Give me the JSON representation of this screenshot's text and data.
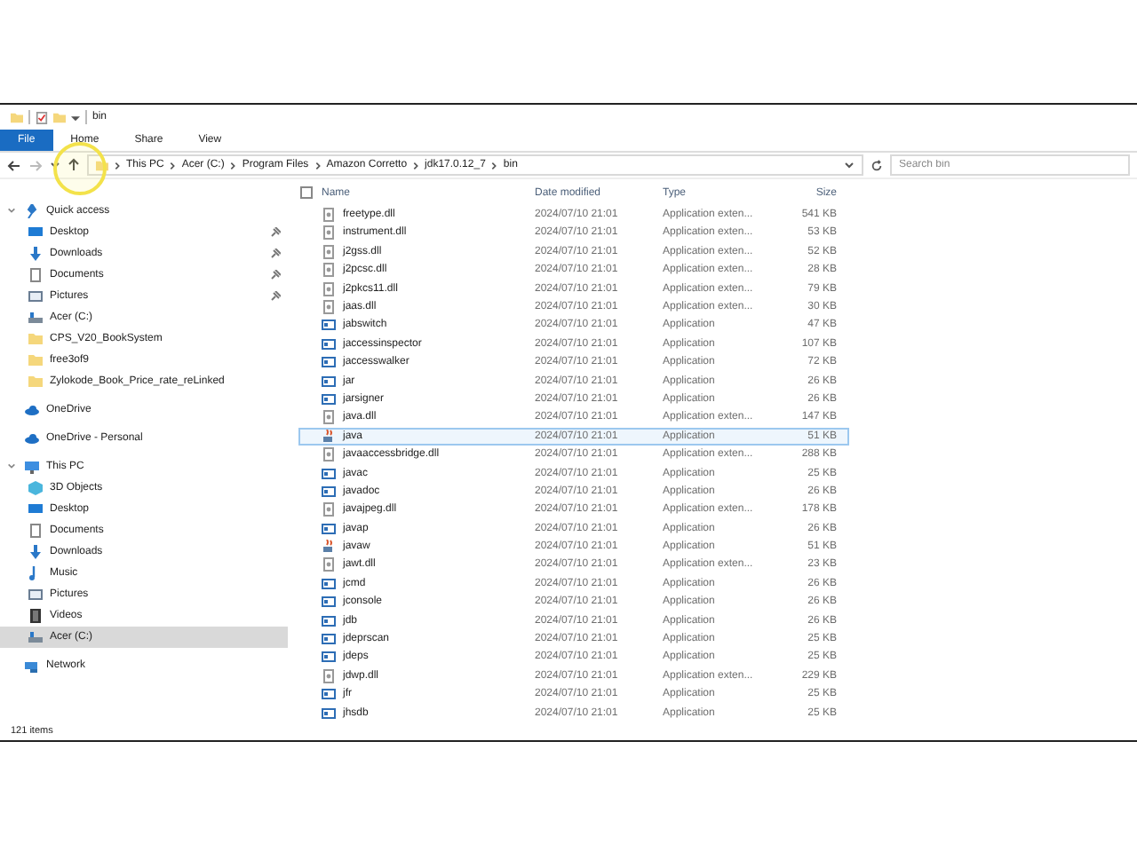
{
  "window": {
    "title": "bin"
  },
  "ribbon_tabs": [
    {
      "label": "File",
      "selected": false,
      "kind": "file"
    },
    {
      "label": "Home",
      "selected": false,
      "kind": "tab"
    },
    {
      "label": "Share",
      "selected": false,
      "kind": "tab"
    },
    {
      "label": "View",
      "selected": false,
      "kind": "tab"
    }
  ],
  "address": {
    "path": [
      "This PC",
      "Acer (C:)",
      "Program Files",
      "Amazon Corretto",
      "jdk17.0.12_7",
      "bin"
    ]
  },
  "search": {
    "placeholder": "Search bin"
  },
  "sidebar": {
    "items": [
      {
        "label": "Quick access",
        "kind": "star",
        "expanded": true,
        "selected": false,
        "children": [
          {
            "label": "Desktop",
            "kind": "desktop",
            "pinned": true,
            "selected": false
          },
          {
            "label": "Downloads",
            "kind": "download",
            "pinned": true,
            "selected": false
          },
          {
            "label": "Documents",
            "kind": "document",
            "pinned": true,
            "selected": false
          },
          {
            "label": "Pictures",
            "kind": "pictures",
            "pinned": true,
            "selected": false
          },
          {
            "label": "Acer (C:)",
            "kind": "drive",
            "pinned": false,
            "selected": false
          },
          {
            "label": "CPS_V20_BookSystem",
            "kind": "folder",
            "pinned": false,
            "selected": false
          },
          {
            "label": "free3of9",
            "kind": "folder",
            "pinned": false,
            "selected": false
          },
          {
            "label": "Zylokode_Book_Price_rate_reLinked",
            "kind": "folder",
            "pinned": false,
            "selected": false
          }
        ]
      },
      {
        "label": "OneDrive",
        "kind": "cloud",
        "selected": false
      },
      {
        "label": "OneDrive - Personal",
        "kind": "cloud",
        "selected": false
      },
      {
        "label": "This PC",
        "kind": "pc",
        "expanded": true,
        "selected": false,
        "children": [
          {
            "label": "3D Objects",
            "kind": "cube",
            "selected": false
          },
          {
            "label": "Desktop",
            "kind": "desktop",
            "selected": false
          },
          {
            "label": "Documents",
            "kind": "document",
            "selected": false
          },
          {
            "label": "Downloads",
            "kind": "download",
            "selected": false
          },
          {
            "label": "Music",
            "kind": "music",
            "selected": false
          },
          {
            "label": "Pictures",
            "kind": "pictures",
            "selected": false
          },
          {
            "label": "Videos",
            "kind": "video",
            "selected": false
          },
          {
            "label": "Acer (C:)",
            "kind": "drive",
            "selected": true
          }
        ]
      },
      {
        "label": "Network",
        "kind": "network",
        "selected": false
      }
    ]
  },
  "table": {
    "select_all": {
      "checked": false
    },
    "columns": [
      "Name",
      "Date modified",
      "Type",
      "Size"
    ],
    "rows": [
      {
        "name": "freetype.dll",
        "kind": "dll",
        "date": "2024/07/10 21:01",
        "type": "Application exten...",
        "size": "541 KB",
        "selected": false
      },
      {
        "name": "instrument.dll",
        "kind": "dll",
        "date": "2024/07/10 21:01",
        "type": "Application exten...",
        "size": "53 KB",
        "selected": false
      },
      {
        "name": "j2gss.dll",
        "kind": "dll",
        "date": "2024/07/10 21:01",
        "type": "Application exten...",
        "size": "52 KB",
        "selected": false
      },
      {
        "name": "j2pcsc.dll",
        "kind": "dll",
        "date": "2024/07/10 21:01",
        "type": "Application exten...",
        "size": "28 KB",
        "selected": false
      },
      {
        "name": "j2pkcs11.dll",
        "kind": "dll",
        "date": "2024/07/10 21:01",
        "type": "Application exten...",
        "size": "79 KB",
        "selected": false
      },
      {
        "name": "jaas.dll",
        "kind": "dll",
        "date": "2024/07/10 21:01",
        "type": "Application exten...",
        "size": "30 KB",
        "selected": false
      },
      {
        "name": "jabswitch",
        "kind": "app",
        "date": "2024/07/10 21:01",
        "type": "Application",
        "size": "47 KB",
        "selected": false
      },
      {
        "name": "jaccessinspector",
        "kind": "app",
        "date": "2024/07/10 21:01",
        "type": "Application",
        "size": "107 KB",
        "selected": false
      },
      {
        "name": "jaccesswalker",
        "kind": "app",
        "date": "2024/07/10 21:01",
        "type": "Application",
        "size": "72 KB",
        "selected": false
      },
      {
        "name": "jar",
        "kind": "app",
        "date": "2024/07/10 21:01",
        "type": "Application",
        "size": "26 KB",
        "selected": false
      },
      {
        "name": "jarsigner",
        "kind": "app",
        "date": "2024/07/10 21:01",
        "type": "Application",
        "size": "26 KB",
        "selected": false
      },
      {
        "name": "java.dll",
        "kind": "dll",
        "date": "2024/07/10 21:01",
        "type": "Application exten...",
        "size": "147 KB",
        "selected": false
      },
      {
        "name": "java",
        "kind": "java",
        "date": "2024/07/10 21:01",
        "type": "Application",
        "size": "51 KB",
        "selected": true
      },
      {
        "name": "javaaccessbridge.dll",
        "kind": "dll",
        "date": "2024/07/10 21:01",
        "type": "Application exten...",
        "size": "288 KB",
        "selected": false
      },
      {
        "name": "javac",
        "kind": "app",
        "date": "2024/07/10 21:01",
        "type": "Application",
        "size": "25 KB",
        "selected": false
      },
      {
        "name": "javadoc",
        "kind": "app",
        "date": "2024/07/10 21:01",
        "type": "Application",
        "size": "26 KB",
        "selected": false
      },
      {
        "name": "javajpeg.dll",
        "kind": "dll",
        "date": "2024/07/10 21:01",
        "type": "Application exten...",
        "size": "178 KB",
        "selected": false
      },
      {
        "name": "javap",
        "kind": "app",
        "date": "2024/07/10 21:01",
        "type": "Application",
        "size": "26 KB",
        "selected": false
      },
      {
        "name": "javaw",
        "kind": "java",
        "date": "2024/07/10 21:01",
        "type": "Application",
        "size": "51 KB",
        "selected": false
      },
      {
        "name": "jawt.dll",
        "kind": "dll",
        "date": "2024/07/10 21:01",
        "type": "Application exten...",
        "size": "23 KB",
        "selected": false
      },
      {
        "name": "jcmd",
        "kind": "app",
        "date": "2024/07/10 21:01",
        "type": "Application",
        "size": "26 KB",
        "selected": false
      },
      {
        "name": "jconsole",
        "kind": "app",
        "date": "2024/07/10 21:01",
        "type": "Application",
        "size": "26 KB",
        "selected": false
      },
      {
        "name": "jdb",
        "kind": "app",
        "date": "2024/07/10 21:01",
        "type": "Application",
        "size": "26 KB",
        "selected": false
      },
      {
        "name": "jdeprscan",
        "kind": "app",
        "date": "2024/07/10 21:01",
        "type": "Application",
        "size": "25 KB",
        "selected": false
      },
      {
        "name": "jdeps",
        "kind": "app",
        "date": "2024/07/10 21:01",
        "type": "Application",
        "size": "25 KB",
        "selected": false
      },
      {
        "name": "jdwp.dll",
        "kind": "dll",
        "date": "2024/07/10 21:01",
        "type": "Application exten...",
        "size": "229 KB",
        "selected": false
      },
      {
        "name": "jfr",
        "kind": "app",
        "date": "2024/07/10 21:01",
        "type": "Application",
        "size": "25 KB",
        "selected": false
      },
      {
        "name": "jhsdb",
        "kind": "app",
        "date": "2024/07/10 21:01",
        "type": "Application",
        "size": "25 KB",
        "selected": false
      }
    ]
  },
  "status_bar": {
    "count": "121 items"
  }
}
